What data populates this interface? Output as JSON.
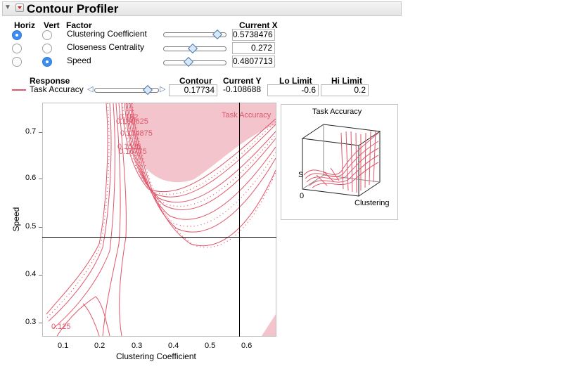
{
  "panel": {
    "title": "Contour Profiler"
  },
  "factor_table": {
    "headers": {
      "horiz": "Horiz",
      "vert": "Vert",
      "factor": "Factor",
      "current_x": "Current X"
    },
    "rows": [
      {
        "name": "Clustering Coefficient",
        "value": "0.5738476",
        "horiz": true,
        "vert": false,
        "slider_level": 0.86
      },
      {
        "name": "Closeness Centrality",
        "value": "0.272",
        "horiz": false,
        "vert": false,
        "slider_level": 0.47
      },
      {
        "name": "Speed",
        "value": "0.4807713",
        "horiz": false,
        "vert": true,
        "slider_level": 0.4
      }
    ]
  },
  "response_table": {
    "headers": {
      "response": "Response",
      "contour": "Contour",
      "current_y": "Current Y",
      "lo_limit": "Lo Limit",
      "hi_limit": "Hi Limit"
    },
    "rows": [
      {
        "name": "Task Accuracy",
        "contour": "0.17734",
        "current_y": "-0.108688",
        "lo_limit": "-0.6",
        "hi_limit": "0.2",
        "slider_level": 0.83
      }
    ]
  },
  "colors": {
    "contour": "#e0566a",
    "shade": "#f3c4cb",
    "radio_on": "#3d8df0",
    "crosshair": "#000000"
  },
  "chart_data": [
    {
      "type": "contour",
      "xlabel": "Clustering Coefficient",
      "ylabel": "Speed",
      "xlim": [
        0.05,
        0.68
      ],
      "ylim": [
        0.27,
        0.77
      ],
      "x_ticks": [
        "0.1",
        "0.2",
        "0.3",
        "0.4",
        "0.5",
        "0.6"
      ],
      "y_ticks": [
        "0.3",
        "0.4",
        "0.5",
        "0.6",
        "0.7"
      ],
      "crosshair": {
        "x": 0.5738476,
        "y": 0.4807713
      },
      "response_label": "Task Accuracy",
      "contour_labels": [
        "0.182",
        "0.160625",
        "0.174875",
        "0.1535",
        "0.16775",
        "0.125"
      ]
    },
    {
      "type": "surface",
      "title": "Task Accuracy",
      "axis_labels": {
        "x": "Clustering",
        "y": "S",
        "origin": "0"
      }
    }
  ]
}
